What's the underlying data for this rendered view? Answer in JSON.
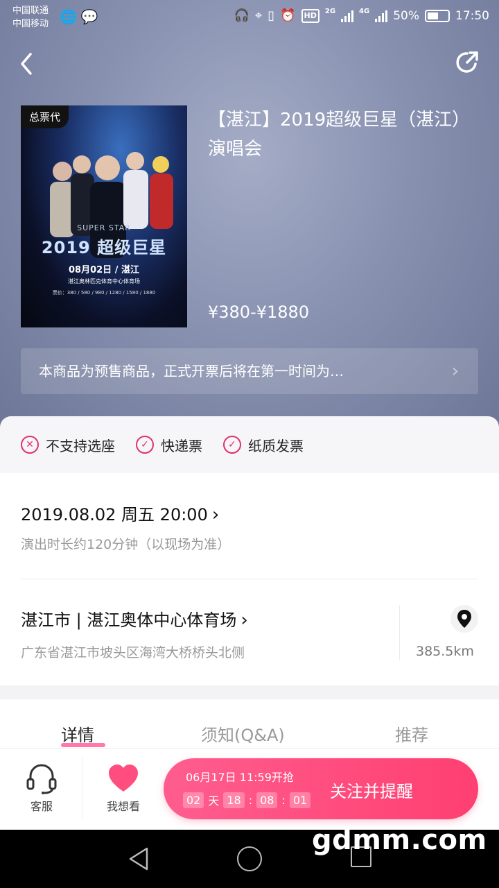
{
  "status_bar": {
    "carrier1": "中国联通",
    "carrier2": "中国移动",
    "signal1": "2G",
    "signal2": "4G",
    "battery": "50%",
    "time": "17:50"
  },
  "poster": {
    "badge": "总票代",
    "super_star": "SUPER STAR",
    "headline": "2019 超级巨星",
    "date": "08月02日 / 湛江",
    "venue": "湛江奥林匹克体育中心体育场",
    "prices": "票价：380 / 580 / 980 / 1280 / 1580 / 1880"
  },
  "event": {
    "title": "【湛江】2019超级巨星（湛江）演唱会",
    "price": "¥380-¥1880",
    "notice": "本商品为预售商品，正式开票后将在第一时间为…"
  },
  "tags": [
    {
      "label": "不支持选座",
      "type": "no"
    },
    {
      "label": "快递票",
      "type": "yes"
    },
    {
      "label": "纸质发票",
      "type": "yes"
    }
  ],
  "schedule": {
    "datetime": "2019.08.02 周五 20:00",
    "duration": "演出时长约120分钟（以现场为准）"
  },
  "venue": {
    "name": "湛江市 | 湛江奥体中心体育场",
    "address": "广东省湛江市坡头区海湾大桥桥头北侧",
    "distance": "385.5km"
  },
  "tabs": [
    "详情",
    "须知(Q&A)",
    "推荐"
  ],
  "actions": {
    "service": "客服",
    "want": "我想看",
    "sale_time": "06月17日 11:59开抢",
    "countdown": {
      "days": "02",
      "day_unit": "天",
      "hours": "18",
      "minutes": "08",
      "seconds": "01"
    },
    "cta": "关注并提醒"
  },
  "watermark": "gdmm.com",
  "colors": {
    "accent": "#ff4d80",
    "tag": "#e0306f"
  }
}
